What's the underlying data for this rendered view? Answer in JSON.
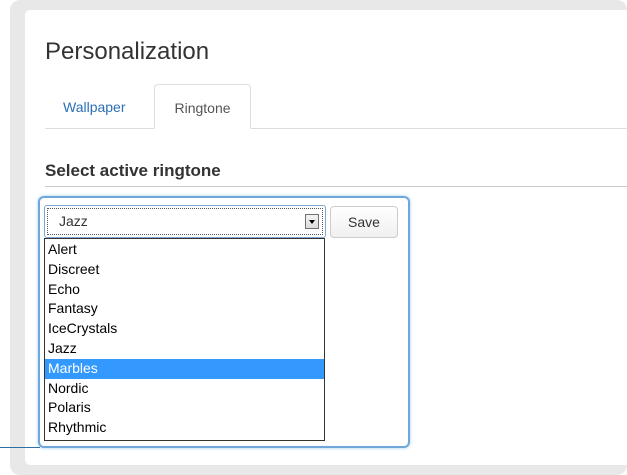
{
  "page": {
    "title": "Personalization"
  },
  "tabs": [
    {
      "label": "Wallpaper",
      "active": false
    },
    {
      "label": "Ringtone",
      "active": true
    }
  ],
  "section": {
    "heading": "Select active ringtone"
  },
  "ringtone_select": {
    "selected_value": "Jazz",
    "options": [
      "Alert",
      "Discreet",
      "Echo",
      "Fantasy",
      "IceCrystals",
      "Jazz",
      "Marbles",
      "Nordic",
      "Polaris",
      "Rhythmic"
    ],
    "highlighted_option": "Marbles",
    "expanded": true
  },
  "save_button": {
    "label": "Save"
  },
  "colors": {
    "link_tab": "#2a6fb8",
    "highlight": "#3399ff",
    "focus_ring": "#6fa8d8"
  }
}
